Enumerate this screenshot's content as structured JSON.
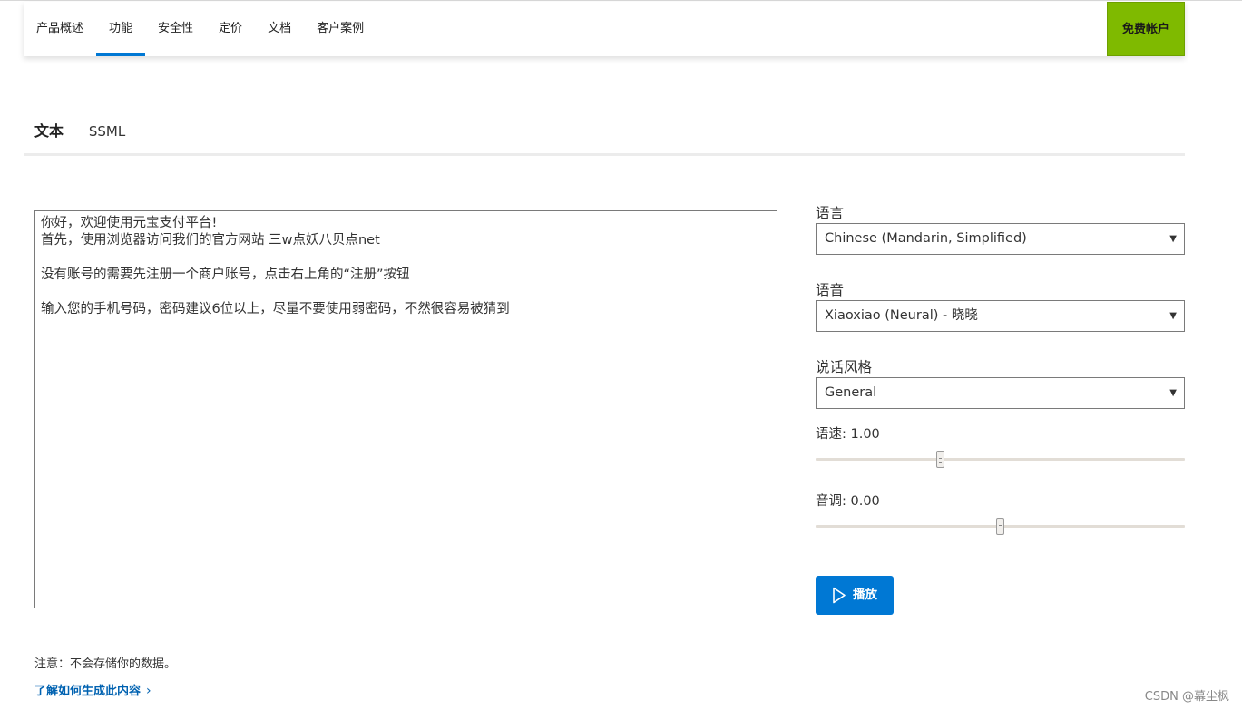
{
  "nav": {
    "items": [
      {
        "label": "产品概述"
      },
      {
        "label": "功能",
        "active": true
      },
      {
        "label": "安全性"
      },
      {
        "label": "定价"
      },
      {
        "label": "文档"
      },
      {
        "label": "客户案例"
      }
    ],
    "free_account": "免费帐户",
    "accent": "#0078d4",
    "free_account_color": "#7fba00"
  },
  "tabs": {
    "text": "文本",
    "ssml": "SSML",
    "active": "text"
  },
  "editor": {
    "lines": [
      "你好，欢迎使用元宝支付平台!",
      "首先，使用浏览器访问我们的官方网站 三w点妖八贝点net",
      "",
      "没有账号的需要先注册一个商户账号，点击右上角的“注册”按钮",
      "",
      "输入您的手机号码，密码建议6位以上，尽量不要使用弱密码，不然很容易被猜到"
    ]
  },
  "settings": {
    "language_label": "语言",
    "language_value": "Chinese (Mandarin, Simplified)",
    "voice_label": "语音",
    "voice_value": "Xiaoxiao (Neural) - 晓晓",
    "style_label": "说话风格",
    "style_value": "General",
    "speed_label": "语速: 1.00",
    "speed_fraction": 0.34,
    "pitch_label": "音调: 0.00",
    "pitch_fraction": 0.5
  },
  "play": {
    "label": "播放",
    "icon": "play-icon"
  },
  "footer": {
    "note": "注意：不会存储你的数据。",
    "learn_link": "了解如何生成此内容",
    "watermark": "CSDN @幕尘枫"
  }
}
